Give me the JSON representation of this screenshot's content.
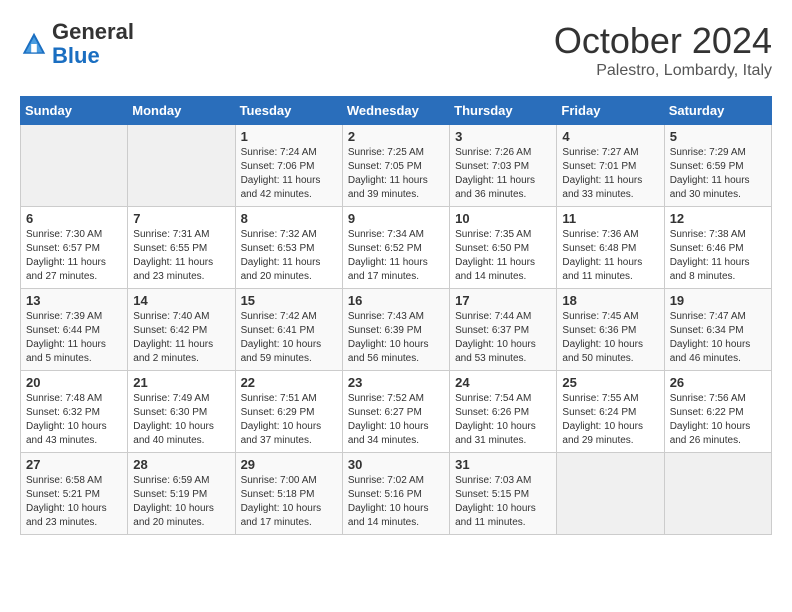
{
  "header": {
    "logo_general": "General",
    "logo_blue": "Blue",
    "month_title": "October 2024",
    "subtitle": "Palestro, Lombardy, Italy"
  },
  "days_of_week": [
    "Sunday",
    "Monday",
    "Tuesday",
    "Wednesday",
    "Thursday",
    "Friday",
    "Saturday"
  ],
  "weeks": [
    [
      {
        "day": "",
        "content": ""
      },
      {
        "day": "",
        "content": ""
      },
      {
        "day": "1",
        "content": "Sunrise: 7:24 AM\nSunset: 7:06 PM\nDaylight: 11 hours and 42 minutes."
      },
      {
        "day": "2",
        "content": "Sunrise: 7:25 AM\nSunset: 7:05 PM\nDaylight: 11 hours and 39 minutes."
      },
      {
        "day": "3",
        "content": "Sunrise: 7:26 AM\nSunset: 7:03 PM\nDaylight: 11 hours and 36 minutes."
      },
      {
        "day": "4",
        "content": "Sunrise: 7:27 AM\nSunset: 7:01 PM\nDaylight: 11 hours and 33 minutes."
      },
      {
        "day": "5",
        "content": "Sunrise: 7:29 AM\nSunset: 6:59 PM\nDaylight: 11 hours and 30 minutes."
      }
    ],
    [
      {
        "day": "6",
        "content": "Sunrise: 7:30 AM\nSunset: 6:57 PM\nDaylight: 11 hours and 27 minutes."
      },
      {
        "day": "7",
        "content": "Sunrise: 7:31 AM\nSunset: 6:55 PM\nDaylight: 11 hours and 23 minutes."
      },
      {
        "day": "8",
        "content": "Sunrise: 7:32 AM\nSunset: 6:53 PM\nDaylight: 11 hours and 20 minutes."
      },
      {
        "day": "9",
        "content": "Sunrise: 7:34 AM\nSunset: 6:52 PM\nDaylight: 11 hours and 17 minutes."
      },
      {
        "day": "10",
        "content": "Sunrise: 7:35 AM\nSunset: 6:50 PM\nDaylight: 11 hours and 14 minutes."
      },
      {
        "day": "11",
        "content": "Sunrise: 7:36 AM\nSunset: 6:48 PM\nDaylight: 11 hours and 11 minutes."
      },
      {
        "day": "12",
        "content": "Sunrise: 7:38 AM\nSunset: 6:46 PM\nDaylight: 11 hours and 8 minutes."
      }
    ],
    [
      {
        "day": "13",
        "content": "Sunrise: 7:39 AM\nSunset: 6:44 PM\nDaylight: 11 hours and 5 minutes."
      },
      {
        "day": "14",
        "content": "Sunrise: 7:40 AM\nSunset: 6:42 PM\nDaylight: 11 hours and 2 minutes."
      },
      {
        "day": "15",
        "content": "Sunrise: 7:42 AM\nSunset: 6:41 PM\nDaylight: 10 hours and 59 minutes."
      },
      {
        "day": "16",
        "content": "Sunrise: 7:43 AM\nSunset: 6:39 PM\nDaylight: 10 hours and 56 minutes."
      },
      {
        "day": "17",
        "content": "Sunrise: 7:44 AM\nSunset: 6:37 PM\nDaylight: 10 hours and 53 minutes."
      },
      {
        "day": "18",
        "content": "Sunrise: 7:45 AM\nSunset: 6:36 PM\nDaylight: 10 hours and 50 minutes."
      },
      {
        "day": "19",
        "content": "Sunrise: 7:47 AM\nSunset: 6:34 PM\nDaylight: 10 hours and 46 minutes."
      }
    ],
    [
      {
        "day": "20",
        "content": "Sunrise: 7:48 AM\nSunset: 6:32 PM\nDaylight: 10 hours and 43 minutes."
      },
      {
        "day": "21",
        "content": "Sunrise: 7:49 AM\nSunset: 6:30 PM\nDaylight: 10 hours and 40 minutes."
      },
      {
        "day": "22",
        "content": "Sunrise: 7:51 AM\nSunset: 6:29 PM\nDaylight: 10 hours and 37 minutes."
      },
      {
        "day": "23",
        "content": "Sunrise: 7:52 AM\nSunset: 6:27 PM\nDaylight: 10 hours and 34 minutes."
      },
      {
        "day": "24",
        "content": "Sunrise: 7:54 AM\nSunset: 6:26 PM\nDaylight: 10 hours and 31 minutes."
      },
      {
        "day": "25",
        "content": "Sunrise: 7:55 AM\nSunset: 6:24 PM\nDaylight: 10 hours and 29 minutes."
      },
      {
        "day": "26",
        "content": "Sunrise: 7:56 AM\nSunset: 6:22 PM\nDaylight: 10 hours and 26 minutes."
      }
    ],
    [
      {
        "day": "27",
        "content": "Sunrise: 6:58 AM\nSunset: 5:21 PM\nDaylight: 10 hours and 23 minutes."
      },
      {
        "day": "28",
        "content": "Sunrise: 6:59 AM\nSunset: 5:19 PM\nDaylight: 10 hours and 20 minutes."
      },
      {
        "day": "29",
        "content": "Sunrise: 7:00 AM\nSunset: 5:18 PM\nDaylight: 10 hours and 17 minutes."
      },
      {
        "day": "30",
        "content": "Sunrise: 7:02 AM\nSunset: 5:16 PM\nDaylight: 10 hours and 14 minutes."
      },
      {
        "day": "31",
        "content": "Sunrise: 7:03 AM\nSunset: 5:15 PM\nDaylight: 10 hours and 11 minutes."
      },
      {
        "day": "",
        "content": ""
      },
      {
        "day": "",
        "content": ""
      }
    ]
  ]
}
